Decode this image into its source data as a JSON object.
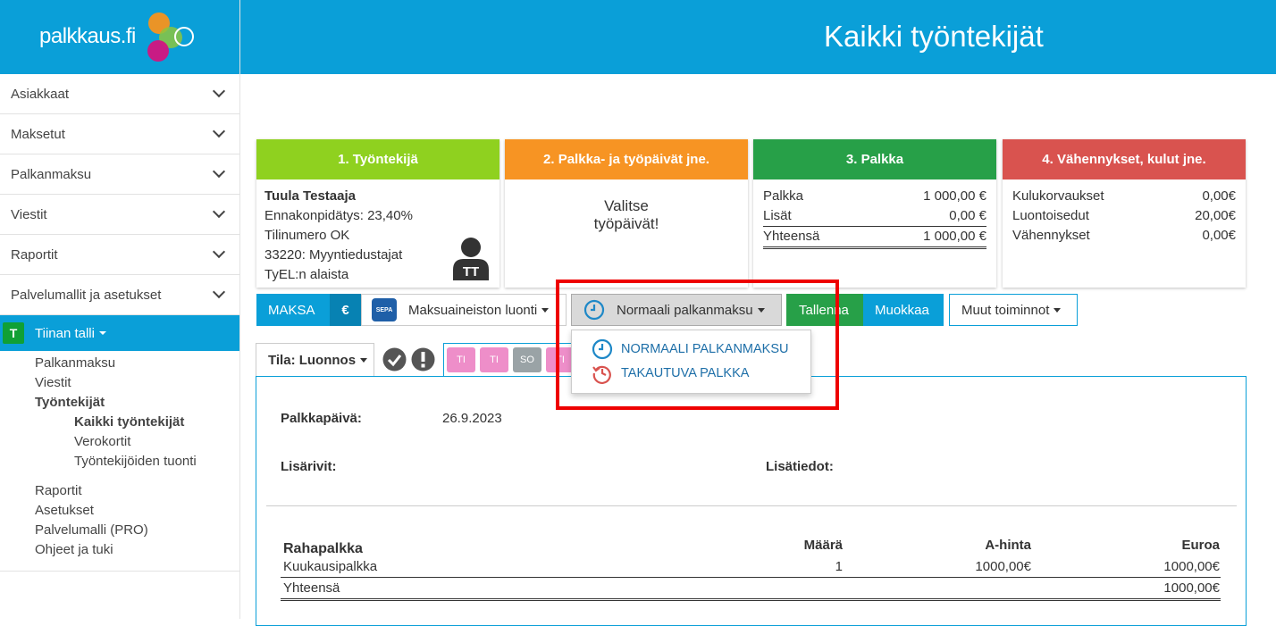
{
  "app": {
    "logo_text": "palkkaus.fi",
    "page_title": "Kaikki työntekijät"
  },
  "sidebar": {
    "items": [
      {
        "label": "Asiakkaat"
      },
      {
        "label": "Maksetut"
      },
      {
        "label": "Palkanmaksu"
      },
      {
        "label": "Viestit"
      },
      {
        "label": "Raportit"
      },
      {
        "label": "Palvelumallit ja asetukset"
      }
    ],
    "tenant": {
      "badge": "T",
      "label": "Tiinan talli"
    },
    "sub": {
      "palkanmaksu": "Palkanmaksu",
      "viestit": "Viestit",
      "tyontekijat": "Työntekijät",
      "kaikki": "Kaikki työntekijät",
      "verokortit": "Verokortit",
      "tuonti": "Työntekijöiden tuonti",
      "raportit": "Raportit",
      "asetukset": "Asetukset",
      "palvelumalli": "Palvelumalli (PRO)",
      "ohjeet": "Ohjeet ja tuki"
    }
  },
  "cards": {
    "c1": {
      "title": "1. Työntekijä",
      "name": "Tuula Testaaja",
      "line1": "Ennakonpidätys: 23,40%",
      "line2": "Tilinumero OK",
      "line3": "33220: Myyntiedustajat",
      "line4": "TyEL:n alaista",
      "avatar_initials": "TT",
      "color": "#8fd11f"
    },
    "c2": {
      "title": "2. Palkka- ja työpäivät jne.",
      "body_line1": "Valitse",
      "body_line2": "työpäivät!",
      "color": "#f79423"
    },
    "c3": {
      "title": "3. Palkka",
      "rows": [
        {
          "label": "Palkka",
          "value": "1 000,00 €"
        },
        {
          "label": "Lisät",
          "value": "0,00 €"
        },
        {
          "label": "Yhteensä",
          "value": "1 000,00 €"
        }
      ],
      "color": "#27a048"
    },
    "c4": {
      "title": "4. Vähennykset, kulut jne.",
      "rows": [
        {
          "label": "Kulukorvaukset",
          "value": "0,00€"
        },
        {
          "label": "Luontoisedut",
          "value": "20,00€"
        },
        {
          "label": "Vähennykset",
          "value": "0,00€"
        }
      ],
      "color": "#d9534f"
    }
  },
  "toolbar": {
    "maksa": "MAKSA",
    "euro": "€",
    "sepa_label": "SEPA",
    "maksuaineisto": "Maksuaineiston luonti",
    "normaali": "Normaali palkanmaksu",
    "tallenna": "Tallenna",
    "muokkaa": "Muokkaa",
    "muut": "Muut toiminnot"
  },
  "dropdown": {
    "items": [
      {
        "label": "NORMAALI PALKANMAKSU"
      },
      {
        "label": "TAKAUTUVA PALKKA"
      }
    ]
  },
  "status": {
    "tila": "Tila: Luonnos",
    "days": [
      {
        "label": "TI",
        "color": "#ee8ec9"
      },
      {
        "label": "TI",
        "color": "#ee8ec9"
      },
      {
        "label": "SO",
        "color": "#9aa3a6"
      },
      {
        "label": "TI",
        "color": "#ee8ec9"
      }
    ]
  },
  "detail": {
    "palkkapaiva_label": "Palkkapäivä:",
    "palkkapaiva_value": "26.9.2023",
    "lisarivit_label": "Lisärivit:",
    "lisatiedot_label": "Lisätiedot:",
    "table": {
      "title": "Rahapalkka",
      "headers": {
        "maara": "Määrä",
        "ahinta": "A-hinta",
        "euroa": "Euroa"
      },
      "row": {
        "name": "Kuukausipalkka",
        "maara": "1",
        "ahinta": "1000,00€",
        "euroa": "1000,00€"
      },
      "total": {
        "name": "Yhteensä",
        "euroa": "1000,00€"
      }
    }
  }
}
